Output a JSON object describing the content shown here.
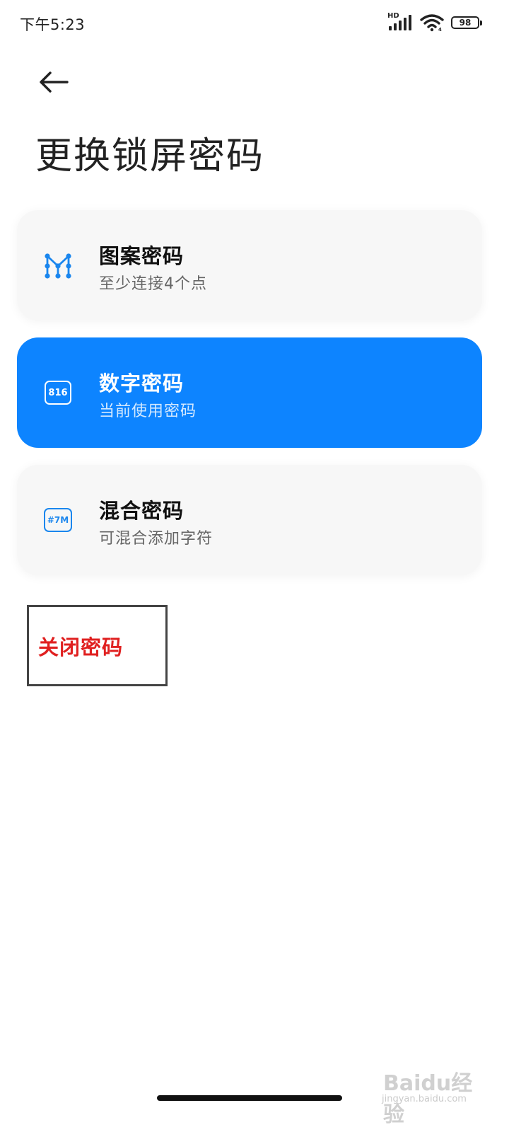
{
  "status_bar": {
    "time": "下午5:23",
    "network_label": "HD",
    "battery_level": "98"
  },
  "page": {
    "title": "更换锁屏密码"
  },
  "options": [
    {
      "title": "图案密码",
      "subtitle": "至少连接4个点",
      "icon": "pattern-icon",
      "active": false
    },
    {
      "title": "数字密码",
      "subtitle": "当前使用密码",
      "icon": "numeric-pin-icon",
      "icon_text": "816",
      "active": true
    },
    {
      "title": "混合密码",
      "subtitle": "可混合添加字符",
      "icon": "mixed-password-icon",
      "icon_text": "#7M",
      "active": false
    }
  ],
  "close_password": {
    "label": "关闭密码"
  },
  "watermark": {
    "main": "Baidu经验",
    "sub": "jingyan.baidu.com"
  },
  "colors": {
    "accent": "#0d84ff",
    "close_text": "#e02020",
    "card_bg": "#f7f7f7"
  }
}
